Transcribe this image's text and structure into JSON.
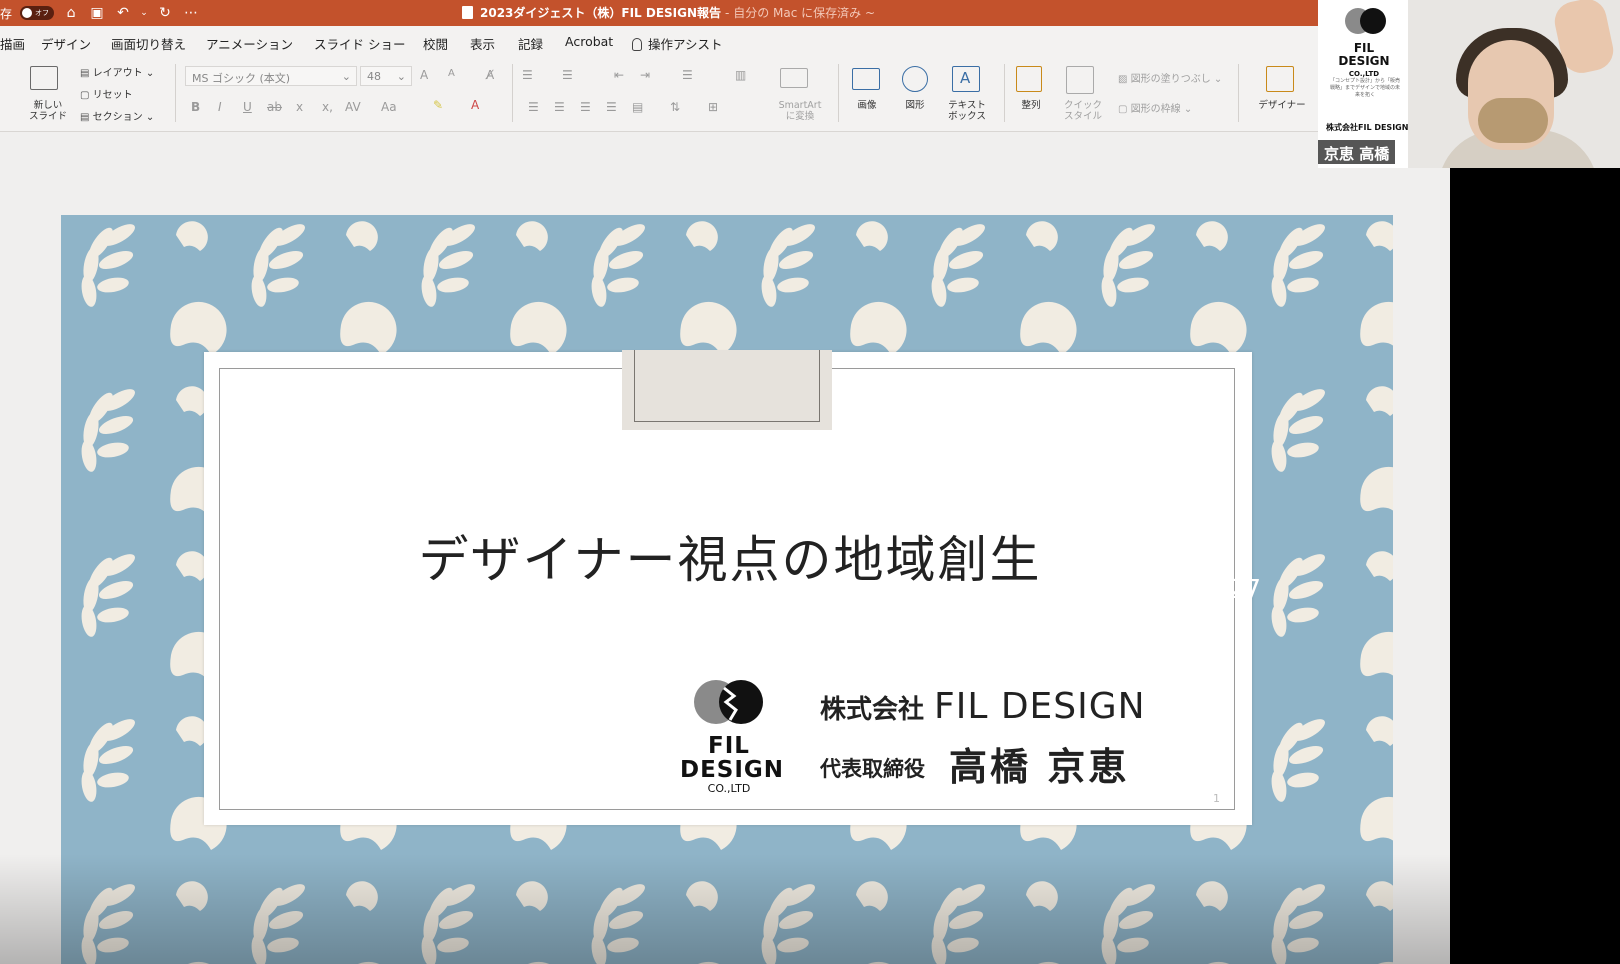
{
  "titlebar": {
    "autosave_label": "存",
    "autosave_state": "オフ",
    "document_title": "2023ダイジェスト（株）FIL DESIGN報告",
    "save_status": "- 自分の Mac に保存済み ~"
  },
  "menu": {
    "items": [
      "描画",
      "デザイン",
      "画面切り替え",
      "アニメーション",
      "スライド ショー",
      "校閲",
      "表示",
      "記録",
      "Acrobat"
    ],
    "assist": "操作アシスト"
  },
  "ribbon": {
    "new_slide": "新しい\nスライド",
    "layout": "レイアウト",
    "reset": "リセット",
    "section": "セクション",
    "font_name": "MS ゴシック (本文)",
    "font_size": "48",
    "smartart": "SmartArt\nに変換",
    "image": "画像",
    "shapes": "図形",
    "textbox": "テキスト\nボックス",
    "arrange": "整列",
    "quick_style": "クイック\nスタイル",
    "shape_fill": "図形の塗りつぶし",
    "shape_outline": "図形の枠線",
    "designer": "デザイナー"
  },
  "slide": {
    "title": "デザイナー視点の地域創生",
    "company_prefix": "株式会社",
    "company_name": "FIL DESIGN",
    "rep_role": "代表取締役",
    "rep_name": "高橋 京恵",
    "logo_line1": "FIL",
    "logo_line2": "DESIGN",
    "logo_co": "CO.,LTD",
    "page_number": "1",
    "date_fragment": "27"
  },
  "video": {
    "brand_line1": "FIL",
    "brand_line2": "DESIGN",
    "brand_co": "CO.,LTD",
    "tagline": "「コンセプト設計」から「販売戦略」までデザインで地域の未来を拓く",
    "company": "株式会社FIL DESIGN",
    "participant_name": "京恵 高橋"
  },
  "colors": {
    "titlebar": "#c3522c",
    "slide_background": "#8fb4c8",
    "pattern_cream": "#f1ece2"
  }
}
